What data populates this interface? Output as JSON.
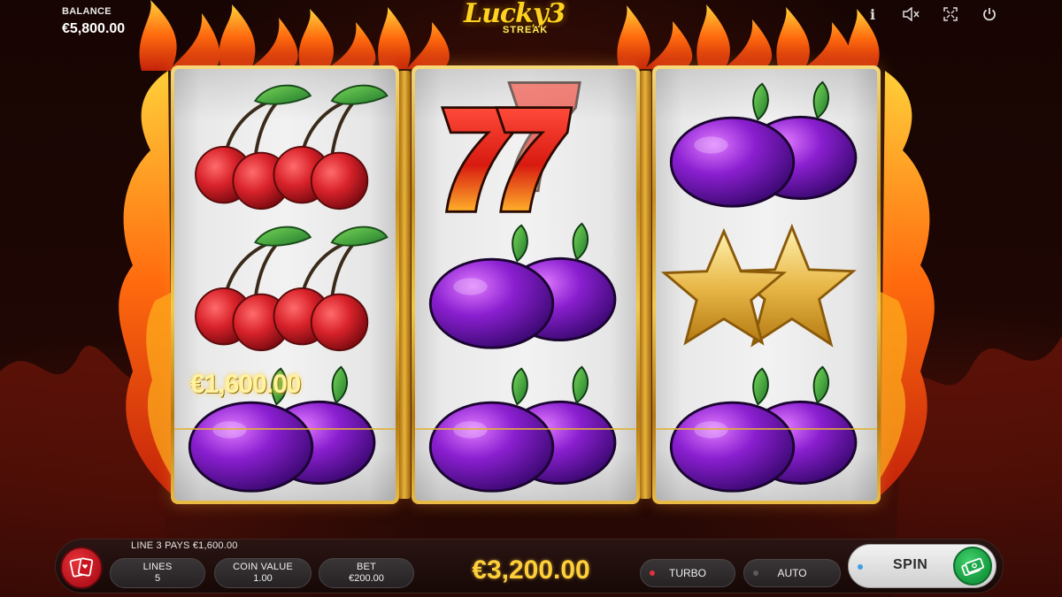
{
  "header": {
    "balance_label": "BALANCE",
    "balance_value": "€5,800.00",
    "logo_main": "Lucky3",
    "logo_sub": "STREAK",
    "icons": [
      "info-icon",
      "mute-icon",
      "fullscreen-icon",
      "power-icon"
    ],
    "info_glyph": "i"
  },
  "reels": [
    [
      "cherries",
      "cherries",
      "plum"
    ],
    [
      "sevens",
      "plum",
      "plum"
    ],
    [
      "plum",
      "stars",
      "plum"
    ]
  ],
  "win_overlay": "€1,600.00",
  "bottom": {
    "line_info": "LINE 3 PAYS €1,600.00",
    "lines_label": "LINES",
    "lines_value": "5",
    "coin_label": "COIN VALUE",
    "coin_value": "1.00",
    "bet_label": "BET",
    "bet_value": "€200.00",
    "total_win": "€3,200.00",
    "turbo_label": "TURBO",
    "auto_label": "AUTO",
    "spin_label": "SPIN"
  },
  "colors": {
    "accent_gold": "#ffcf3a",
    "turbo_dot": "#e0323a",
    "auto_dot": "#5a5a5a",
    "spin_dot": "#3aa0e6"
  }
}
